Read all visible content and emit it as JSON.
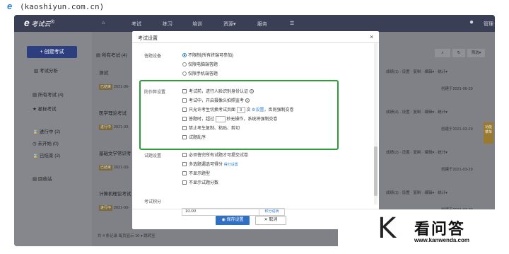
{
  "watermark": {
    "site": "(kaoshiyun.com.cn)"
  },
  "nav": {
    "logo": "考试云",
    "logo_suffix": "®",
    "items": [
      "考试",
      "练习",
      "培训",
      "资源▾",
      "服务"
    ],
    "user": "管理"
  },
  "sidebar": {
    "create_label": "创建考试",
    "analysis_label": "考试分析",
    "items": [
      {
        "label": "所有考试 (4)"
      },
      {
        "label": "星标考试"
      },
      {
        "label": "进行中 (2)"
      },
      {
        "label": "未开始 (0)"
      },
      {
        "label": "已结束 (2)"
      },
      {
        "label": "回收站"
      }
    ]
  },
  "list": {
    "header": "所有考试 (4)",
    "filter_btn": "筛选▾",
    "rows": [
      {
        "title": "测试",
        "status": "已结束",
        "date": "2021-06-",
        "created": "创建于2021-06-29"
      },
      {
        "title": "医学理论考试",
        "status": "进行中",
        "date": "2021-03-",
        "created": "创建于2021-03-29"
      },
      {
        "title": "基础文学常识考",
        "status": "已结束",
        "date": "2021-03-",
        "created": "创建于2021-03-29"
      },
      {
        "title": "计算机理论考试",
        "status": "进行中",
        "date": "2021-03-",
        "created": "创建于2021-03-29"
      }
    ],
    "actions": [
      "成绩",
      "设置",
      "复制",
      "编辑▾",
      "统计▾"
    ],
    "action_counts": [
      "成绩(1)",
      "成绩(4)",
      "成绩(2)",
      "成绩(1)"
    ],
    "pager": {
      "total": "共 4 条记录",
      "per_page_label": "每页显示",
      "per_page": "10 ▾",
      "jump": "跳转至"
    },
    "side_tab": "功能菜单"
  },
  "modal": {
    "title": "考试设置",
    "answer_device": {
      "label": "答题设备",
      "options": [
        "不限制(所有终端可参加)",
        "仅限电脑端答题",
        "仅限手机端答题"
      ],
      "selected": 0
    },
    "anti_cheat": {
      "label": "防作弊设置",
      "items": [
        {
          "text": "考试前，进行人脸识别身份认证"
        },
        {
          "text": "考试中，开启摄像头拍照监考"
        },
        {
          "text_a": "只允许考生切换考试页面",
          "value": "3",
          "text_b": "次",
          "link": "设置",
          "text_c": "，否则强制交卷"
        },
        {
          "text_a": "答题时，超过",
          "text_b": "秒无操作，系统将强制交卷"
        },
        {
          "text": "禁止考生复制、粘贴、剪切"
        },
        {
          "text": "试题乱序"
        }
      ]
    },
    "exam_settings": {
      "label": "试题设置",
      "items": [
        {
          "text": "必须答完所有试题才可提交试卷"
        },
        {
          "text": "多选题漏选可得分",
          "link": "得分设置"
        },
        {
          "text": "不显示题型"
        },
        {
          "text": "不显示试题分数"
        }
      ]
    },
    "score": {
      "label": "考试积分",
      "value": "10.00",
      "tip": "积分说明"
    },
    "save": "保存设置",
    "cancel": "取消",
    "close": "×"
  },
  "brand": {
    "name": "看问答",
    "url": "www.kanwenda.com"
  }
}
